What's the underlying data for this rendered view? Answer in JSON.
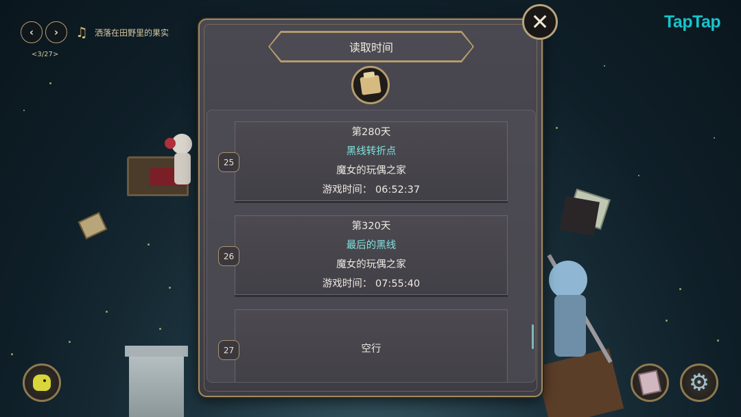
{
  "music": {
    "prev_icon": "chevron-left-icon",
    "next_icon": "chevron-right-icon",
    "prev_glyph": "‹",
    "next_glyph": "›",
    "note_glyph": "♫",
    "song_title": "洒落在田野里的果实",
    "counter": "<3/27>"
  },
  "logo": "TapTap",
  "dialog": {
    "title": "读取时间",
    "close_glyph": "✕",
    "slots": [
      {
        "number": "25",
        "day": "第280天",
        "route": "黑线转折点",
        "location": "魔女的玩偶之家",
        "playtime": "游戏时间：  06:52:37"
      },
      {
        "number": "26",
        "day": "第320天",
        "route": "最后的黑线",
        "location": "魔女的玩偶之家",
        "playtime": "游戏时间：  07:55:40"
      },
      {
        "number": "27",
        "empty_label": "空行"
      }
    ]
  },
  "corner_buttons": {
    "left_icon": "chick-icon",
    "book_icon": "book-icon",
    "settings_icon": "gear-icon",
    "gear_glyph": "⚙"
  },
  "colors": {
    "route_text": "#7fe3e0",
    "frame_gold": "#b49c6c",
    "logo": "#15c5ce"
  }
}
